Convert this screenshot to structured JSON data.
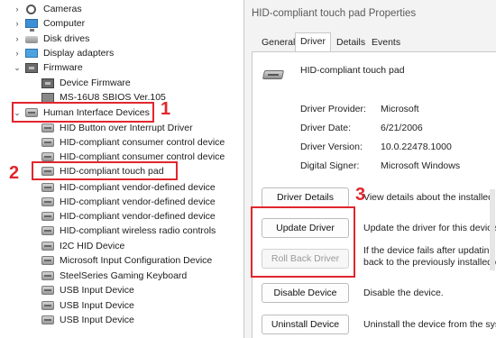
{
  "tree": {
    "items": [
      {
        "label": "Cameras",
        "chevron": "›",
        "icon": "camera-icon"
      },
      {
        "label": "Computer",
        "chevron": "›",
        "icon": "computer-icon"
      },
      {
        "label": "Disk drives",
        "chevron": "›",
        "icon": "disk-drive-icon"
      },
      {
        "label": "Display adapters",
        "chevron": "›",
        "icon": "display-adapter-icon"
      },
      {
        "label": "Firmware",
        "chevron": "⌄",
        "icon": "firmware-icon"
      },
      {
        "label": "Device Firmware",
        "chevron": "",
        "icon": "firmware-icon"
      },
      {
        "label": "MS-16U8 SBIOS Ver.105",
        "chevron": "",
        "icon": "firmware-icon"
      },
      {
        "label": "Human Interface Devices",
        "chevron": "⌄",
        "icon": "hid-icon"
      },
      {
        "label": "HID Button over Interrupt Driver",
        "chevron": "",
        "icon": "hid-icon"
      },
      {
        "label": "HID-compliant consumer control device",
        "chevron": "",
        "icon": "hid-icon"
      },
      {
        "label": "HID-compliant consumer control device",
        "chevron": "",
        "icon": "hid-icon"
      },
      {
        "label": "HID-compliant touch pad",
        "chevron": "",
        "icon": "hid-icon"
      },
      {
        "label": "HID-compliant vendor-defined device",
        "chevron": "",
        "icon": "hid-icon"
      },
      {
        "label": "HID-compliant vendor-defined device",
        "chevron": "",
        "icon": "hid-icon"
      },
      {
        "label": "HID-compliant vendor-defined device",
        "chevron": "",
        "icon": "hid-icon"
      },
      {
        "label": "HID-compliant wireless radio controls",
        "chevron": "",
        "icon": "hid-icon"
      },
      {
        "label": "I2C HID Device",
        "chevron": "",
        "icon": "hid-icon"
      },
      {
        "label": "Microsoft Input Configuration Device",
        "chevron": "",
        "icon": "hid-icon"
      },
      {
        "label": "SteelSeries Gaming Keyboard",
        "chevron": "",
        "icon": "hid-icon"
      },
      {
        "label": "USB Input Device",
        "chevron": "",
        "icon": "hid-icon"
      },
      {
        "label": "USB Input Device",
        "chevron": "",
        "icon": "hid-icon"
      },
      {
        "label": "USB Input Device",
        "chevron": "",
        "icon": "hid-icon"
      }
    ]
  },
  "callouts": {
    "one": "1",
    "two": "2",
    "three": "3"
  },
  "accent_color": "#e0262e",
  "dialog": {
    "title": "HID-compliant touch pad Properties",
    "tabs": [
      "General",
      "Driver",
      "Details",
      "Events"
    ],
    "active_tab": "Driver",
    "device_name": "HID-compliant touch pad",
    "device_icon": "touchpad-device-icon",
    "props": [
      {
        "label": "Driver Provider:",
        "value": "Microsoft"
      },
      {
        "label": "Driver Date:",
        "value": "6/21/2006"
      },
      {
        "label": "Driver Version:",
        "value": "10.0.22478.1000"
      },
      {
        "label": "Digital Signer:",
        "value": "Microsoft Windows"
      }
    ],
    "buttons": [
      {
        "label": "Driver Details",
        "desc": "View details about the installed dr",
        "enabled": true
      },
      {
        "label": "Update Driver",
        "desc": "Update the driver for this device.",
        "enabled": true
      },
      {
        "label": "Roll Back Driver",
        "desc": "If the device fails after updating th",
        "desc2": "back to the previously installed dri",
        "enabled": false
      },
      {
        "label": "Disable Device",
        "desc": "Disable the device.",
        "enabled": true
      },
      {
        "label": "Uninstall Device",
        "desc": "Uninstall the device from the syste",
        "enabled": true
      }
    ]
  }
}
